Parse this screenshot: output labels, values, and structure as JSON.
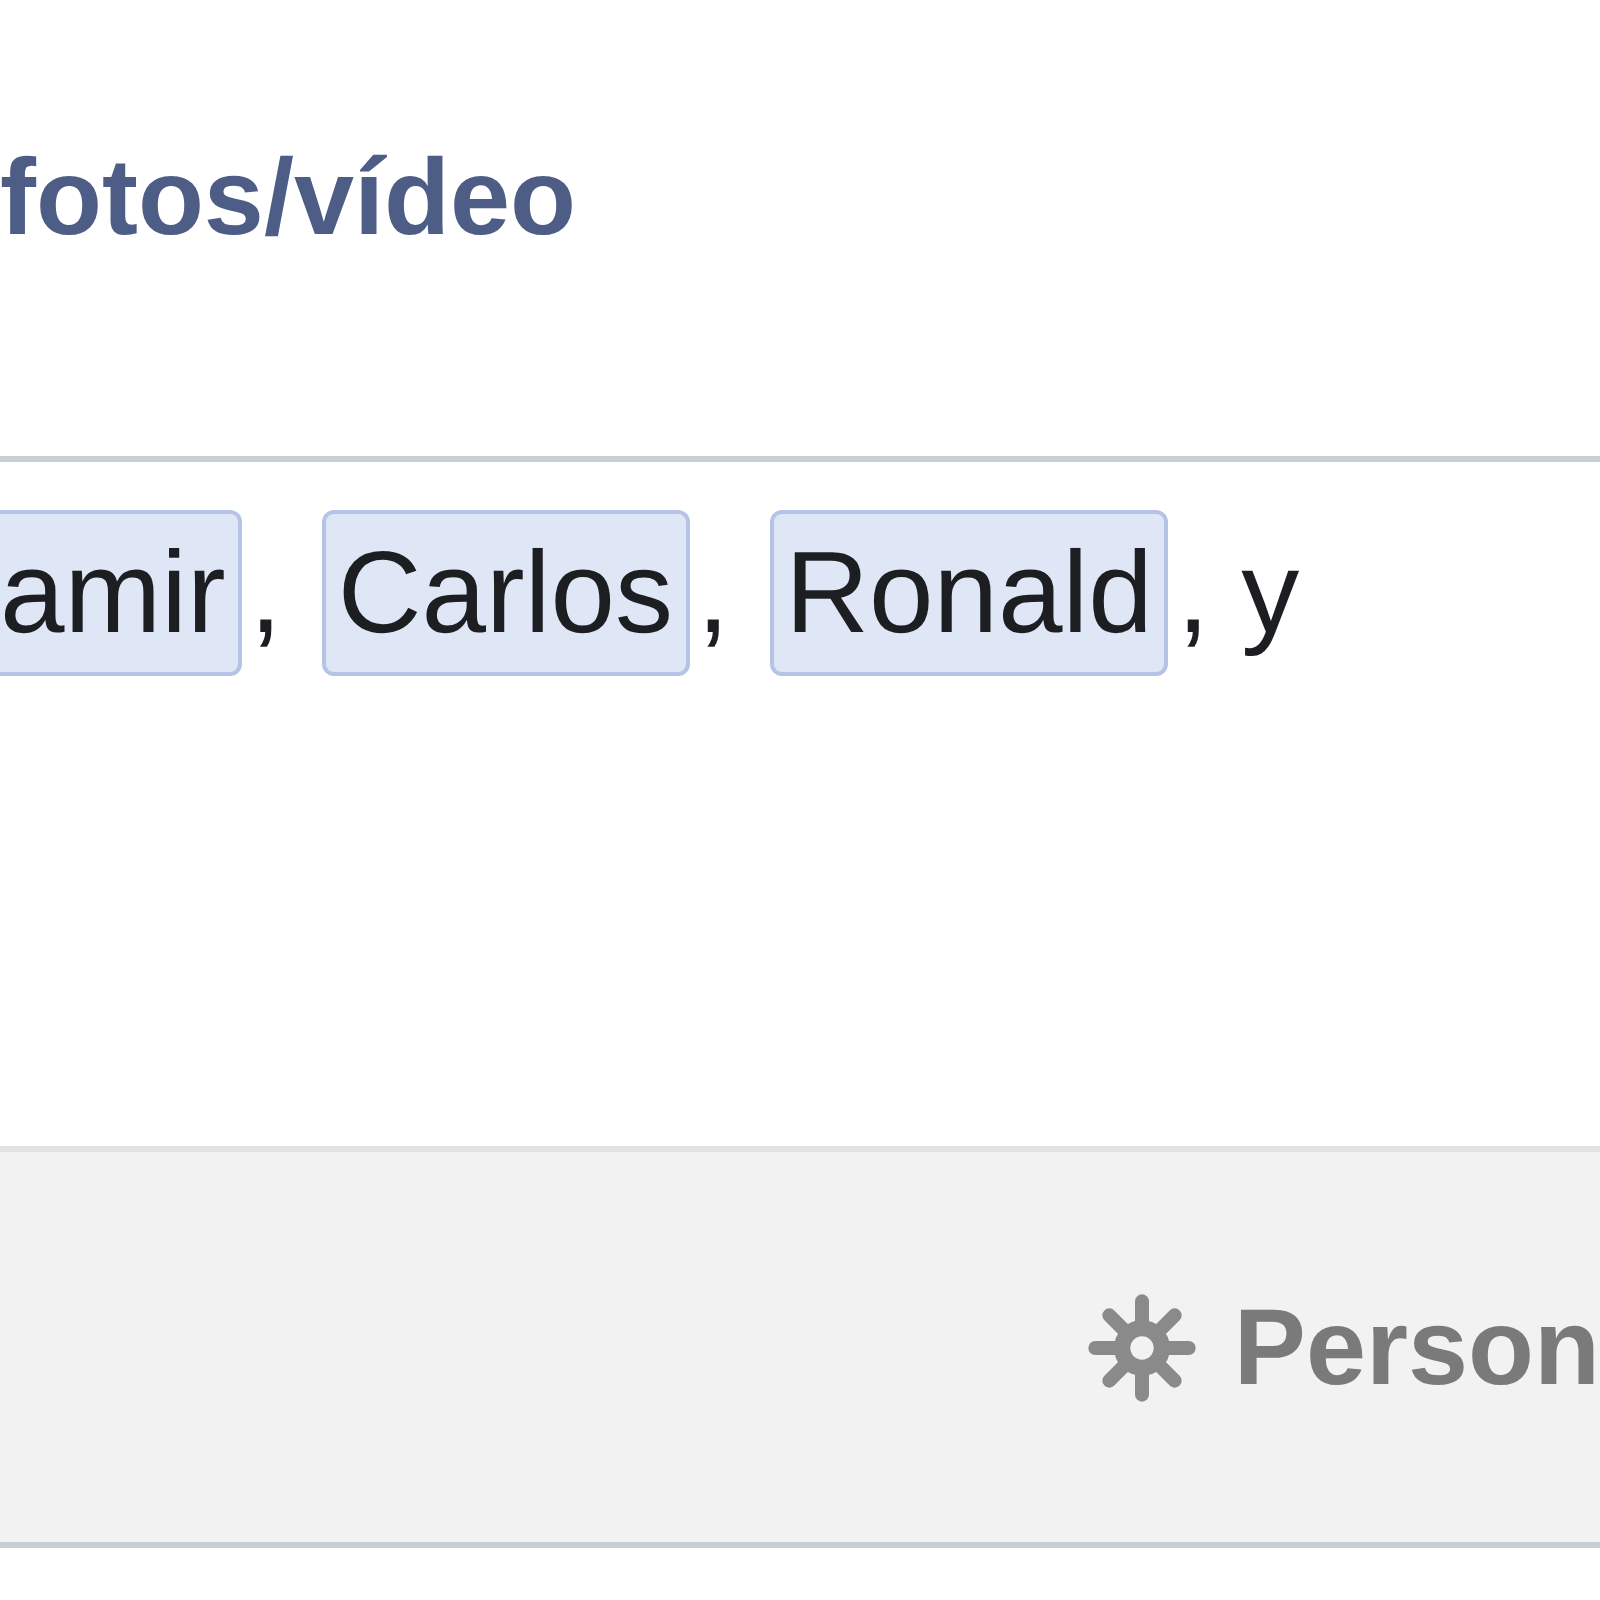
{
  "tab": {
    "label": "fotos/vídeo"
  },
  "composer": {
    "tags": [
      {
        "name": "amir",
        "separator": ","
      },
      {
        "name": "Carlos",
        "separator": ","
      },
      {
        "name": "Ronald",
        "separator": ", y"
      }
    ]
  },
  "footer": {
    "privacy_label": "Person"
  }
}
